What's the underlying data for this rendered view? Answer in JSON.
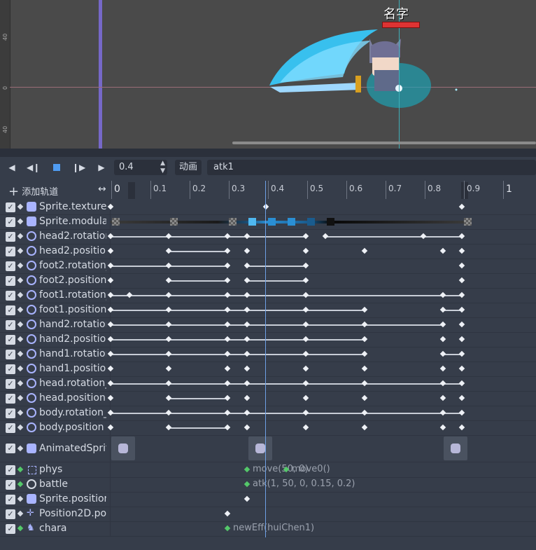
{
  "viewport": {
    "character_name": "名字",
    "ruler_ticks": [
      "40",
      "0",
      "40"
    ]
  },
  "toolbar": {
    "time_value": "0.4",
    "anim_label": "动画",
    "anim_name": "atk1"
  },
  "track_header": {
    "add_track": "添加轨道"
  },
  "timeline_ticks": [
    "0",
    "0.1",
    "0.2",
    "0.3",
    "0.4",
    "0.5",
    "0.6",
    "0.7",
    "0.8",
    "0.9",
    "1"
  ],
  "tracks": [
    {
      "name": "Sprite.texture",
      "icon": "face-icon"
    },
    {
      "name": "Sprite.modulat",
      "icon": "face-icon"
    },
    {
      "name": "head2.rotation",
      "icon": "circle-icon"
    },
    {
      "name": "head2.position",
      "icon": "circle-icon"
    },
    {
      "name": "foot2.rotation_",
      "icon": "circle-icon"
    },
    {
      "name": "foot2.position",
      "icon": "circle-icon"
    },
    {
      "name": "foot1.rotation_",
      "icon": "circle-icon"
    },
    {
      "name": "foot1.position",
      "icon": "circle-icon"
    },
    {
      "name": "hand2.rotation",
      "icon": "circle-icon"
    },
    {
      "name": "hand2.position",
      "icon": "circle-icon"
    },
    {
      "name": "hand1.rotation",
      "icon": "circle-icon"
    },
    {
      "name": "hand1.position",
      "icon": "circle-icon"
    },
    {
      "name": "head.rotation_",
      "icon": "circle-icon"
    },
    {
      "name": "head.position",
      "icon": "circle-icon"
    },
    {
      "name": "body.rotation_",
      "icon": "circle-icon"
    },
    {
      "name": "body.position",
      "icon": "circle-icon"
    }
  ],
  "special_tracks": {
    "animated": {
      "name": "AnimatedSprit"
    },
    "phys": {
      "name": "phys",
      "call_1": "move(50, 0)",
      "call_2": "move0()"
    },
    "battle": {
      "name": "battle",
      "call": "atk(1, 50, 0, 0.15, 0.2)"
    },
    "sprite_pos": {
      "name": "Sprite.position"
    },
    "pos2d": {
      "name": "Position2D.po"
    },
    "chara": {
      "name": "chara",
      "call": "newEff(huiChen1)"
    }
  },
  "colors": {
    "playhead": "#6fa1e6",
    "keyframe": "#eef1f6",
    "method_key": "#54c86a",
    "guide": "#7668c8"
  }
}
